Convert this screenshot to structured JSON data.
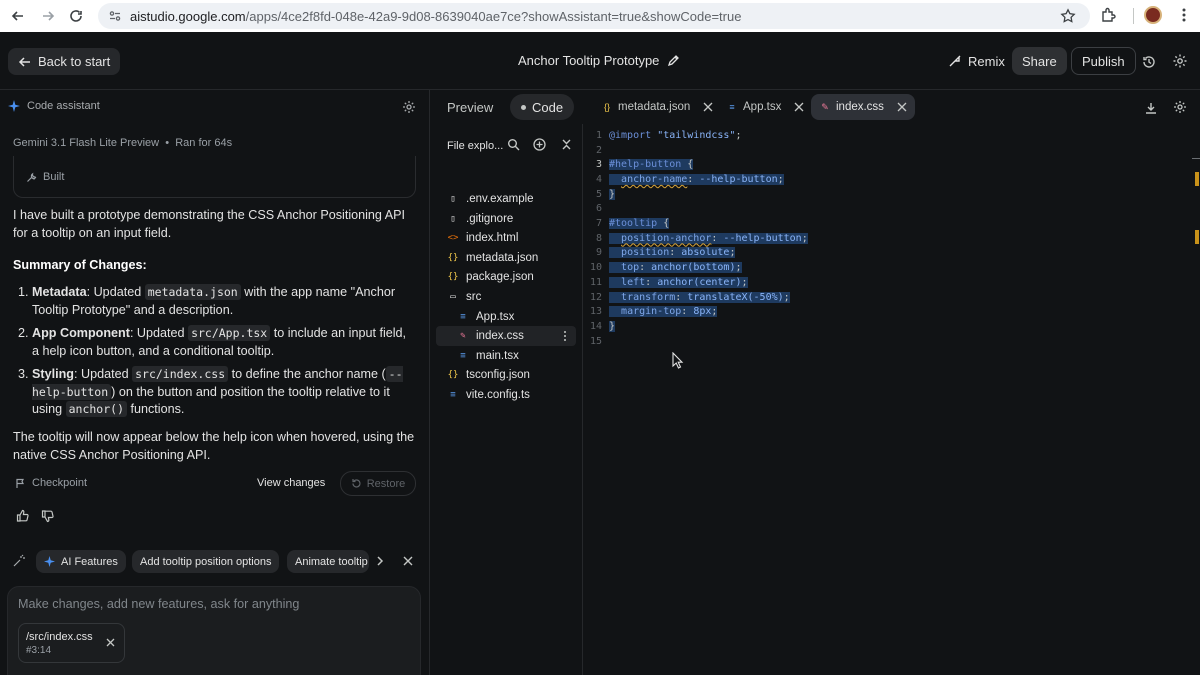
{
  "browser": {
    "url_host": "aistudio.google.com",
    "url_path": "/apps/4ce2f8fd-048e-42a9-9d08-8639040ae7ce?showAssistant=true&showCode=true"
  },
  "header": {
    "back_label": "Back to start",
    "title": "Anchor Tooltip Prototype",
    "remix": "Remix",
    "share": "Share",
    "publish": "Publish"
  },
  "assistant": {
    "title": "Code assistant",
    "model": "Gemini 3.1 Flash Lite Preview",
    "run": "Ran for 64s",
    "built": "Built",
    "intro": "I have built a prototype demonstrating the CSS Anchor Positioning API for a tooltip on an input field.",
    "summary_heading": "Summary of Changes:",
    "items": [
      {
        "num": "1.",
        "bold": "Metadata",
        "t1": ": Updated ",
        "code": "metadata.json",
        "t2": " with the app name \"Anchor Tooltip Prototype\" and a description."
      },
      {
        "num": "2.",
        "bold": "App Component",
        "t1": ": Updated ",
        "code": "src/App.tsx",
        "t2": " to include an input field, a help icon button, and a conditional tooltip."
      },
      {
        "num": "3.",
        "bold": "Styling",
        "t1": ": Updated ",
        "code": "src/index.css",
        "t2": " to define the anchor name (",
        "code2": "--help-button",
        "t3": ") on the button and position the tooltip relative to it using ",
        "code3": "anchor()",
        "t4": " functions."
      }
    ],
    "closing": "The tooltip will now appear below the help icon when hovered, using the native CSS Anchor Positioning API.",
    "checkpoint": "Checkpoint",
    "view_changes": "View changes",
    "restore": "Restore",
    "chips": [
      "AI Features",
      "Add tooltip position options",
      "Animate tooltip"
    ],
    "prompt_placeholder": "Make changes, add new features, ask for anything",
    "file_chip_name": "/src/index.css",
    "file_chip_loc": "#3:14"
  },
  "code_panel": {
    "preview_tab": "Preview",
    "code_tab": "Code",
    "open_tabs": [
      "metadata.json",
      "App.tsx",
      "index.css"
    ],
    "explorer_title": "File explo...",
    "tree": [
      {
        "name": ".env.example",
        "icon": "file-icon",
        "glyph": "▯",
        "color": "#e3e3e3",
        "indent": 0
      },
      {
        "name": ".gitignore",
        "icon": "file-icon",
        "glyph": "▯",
        "color": "#e3e3e3",
        "indent": 0
      },
      {
        "name": "index.html",
        "icon": "html-icon",
        "glyph": "<>",
        "color": "#e8710a",
        "indent": 0
      },
      {
        "name": "metadata.json",
        "icon": "json-icon",
        "glyph": "{}",
        "color": "#f2c94c",
        "indent": 0
      },
      {
        "name": "package.json",
        "icon": "json-icon",
        "glyph": "{}",
        "color": "#f2c94c",
        "indent": 0
      },
      {
        "name": "src",
        "icon": "folder-icon",
        "glyph": "▭",
        "color": "#e3e3e3",
        "indent": 0
      },
      {
        "name": "App.tsx",
        "icon": "tsx-icon",
        "glyph": "≡",
        "color": "#5b9cf0",
        "indent": 1
      },
      {
        "name": "index.css",
        "icon": "css-icon",
        "glyph": "✎",
        "color": "#f07a9a",
        "indent": 1
      },
      {
        "name": "main.tsx",
        "icon": "tsx-icon",
        "glyph": "≡",
        "color": "#5b9cf0",
        "indent": 1
      },
      {
        "name": "tsconfig.json",
        "icon": "json-icon",
        "glyph": "{}",
        "color": "#f2c94c",
        "indent": 0
      },
      {
        "name": "vite.config.ts",
        "icon": "ts-icon",
        "glyph": "≡",
        "color": "#5b9cf0",
        "indent": 0
      }
    ],
    "code_lines": [
      "@import \"tailwindcss\";",
      "",
      "#help-button {",
      "  anchor-name: --help-button;",
      "}",
      "",
      "#tooltip {",
      "  position-anchor: --help-button;",
      "  position: absolute;",
      "  top: anchor(bottom);",
      "  left: anchor(center);",
      "  transform: translateX(-50%);",
      "  margin-top: 8px;",
      "}",
      ""
    ]
  },
  "colors": {
    "accent": "#4a90f0",
    "selection": "#1e3a5f",
    "warning": "#c9921a"
  }
}
